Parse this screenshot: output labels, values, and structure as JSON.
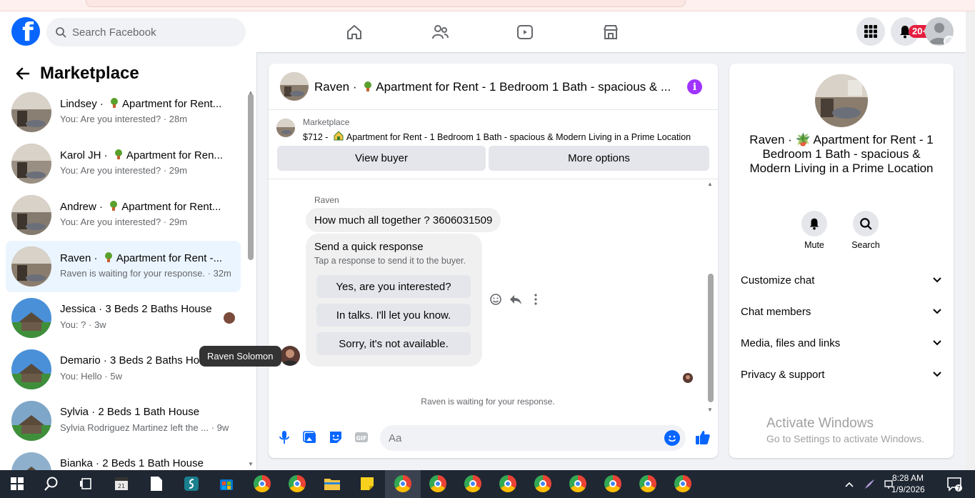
{
  "app": {
    "search_placeholder": "Search Facebook",
    "notification_badge": "20+"
  },
  "sidebar": {
    "title": "Marketplace",
    "conversations": [
      {
        "title": "Lindsey · ",
        "item": "Apartment for Rent...",
        "sub": "You: Are you interested? · 28m"
      },
      {
        "title": "Karol JH · ",
        "item": "Apartment for Ren...",
        "sub": "You: Are you interested? · 29m"
      },
      {
        "title": "Andrew · ",
        "item": "Apartment for Rent...",
        "sub": "You: Are you interested? · 29m"
      },
      {
        "title": "Raven · ",
        "item": "Apartment for Rent -...",
        "sub": "Raven is waiting for your response. · 32m"
      },
      {
        "title": "Jessica · 3 Beds 2 Baths House",
        "item": "",
        "sub": "You: ? · 3w"
      },
      {
        "title": "Demario · 3 Beds 2 Baths House",
        "item": "",
        "sub": "You: Hello · 5w"
      },
      {
        "title": "Sylvia · 2 Beds 1 Bath House",
        "item": "",
        "sub": "Sylvia Rodriguez Martinez left the ... · 9w"
      },
      {
        "title": "Bianka · 2 Beds 1 Bath House",
        "item": "",
        "sub": ""
      }
    ],
    "tooltip": "Raven Solomon"
  },
  "chat": {
    "header_name": "Raven · ",
    "header_item": "Apartment for Rent - 1 Bedroom 1 Bath - spacious & ...",
    "listing_label": "Marketplace",
    "listing_price": "$712 - ",
    "listing_title": "Apartment for Rent - 1 Bedroom 1 Bath - spacious & Modern Living in a Prime Location",
    "view_buyer": "View buyer",
    "more_options": "More options",
    "sender": "Raven",
    "message": "How much all together ? 3606031509",
    "quick_title": "Send a quick response",
    "quick_sub": "Tap a response to send it to the buyer.",
    "quick_responses": [
      "Yes, are you interested?",
      "In talks. I'll let you know.",
      "Sorry, it's not available."
    ],
    "waiting": "Raven is waiting for your response.",
    "composer_placeholder": "Aa"
  },
  "details": {
    "name": "Raven · 🪴 Apartment for Rent - 1 Bedroom 1 Bath - spacious & Modern Living in a Prime Location",
    "mute": "Mute",
    "search": "Search",
    "sections": [
      "Customize chat",
      "Chat members",
      "Media, files and links",
      "Privacy & support"
    ]
  },
  "watermark": {
    "line1": "Activate Windows",
    "line2": "Go to Settings to activate Windows."
  },
  "taskbar": {
    "time": "8:28 AM",
    "date": "1/9/2026",
    "notifications": "7"
  },
  "colors": {
    "brand": "#0866ff",
    "info": "#a033ff",
    "badge": "#e41e3f"
  }
}
